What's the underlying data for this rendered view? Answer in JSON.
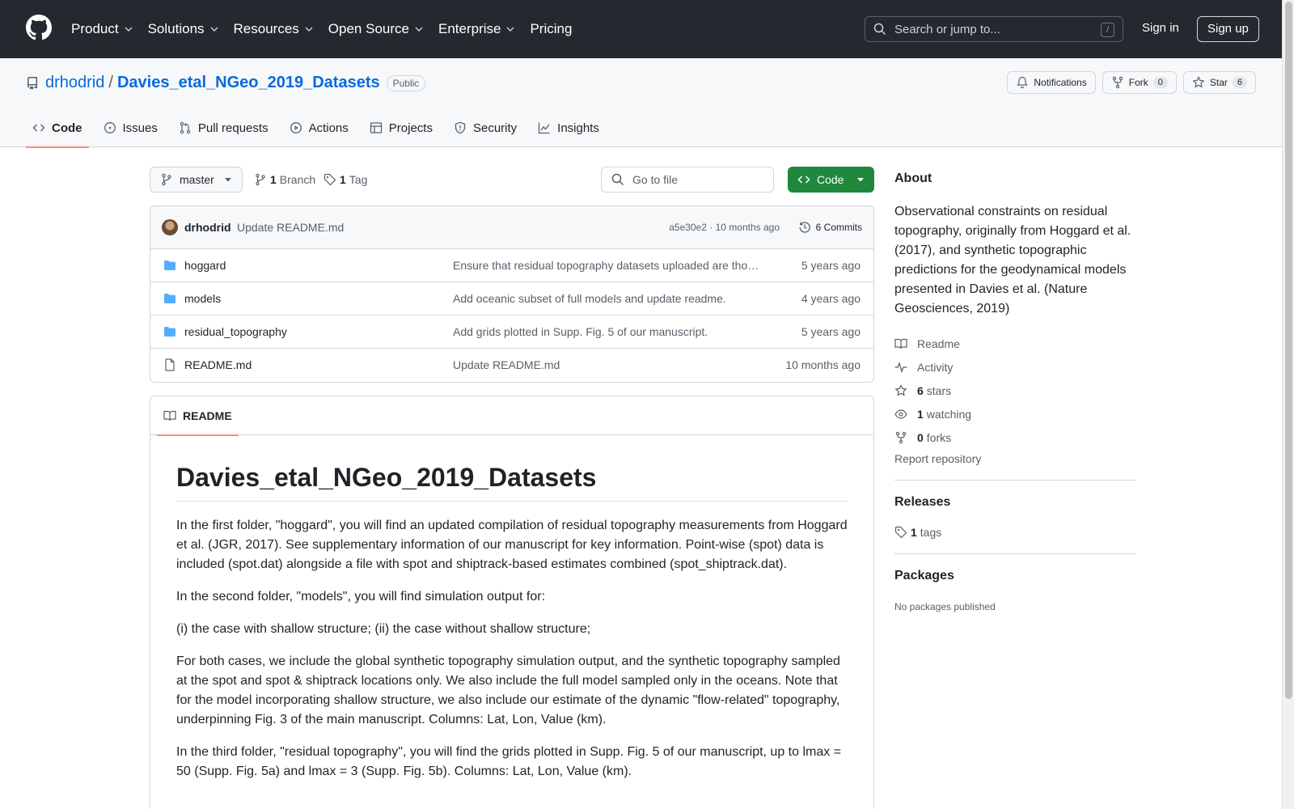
{
  "header": {
    "nav": [
      "Product",
      "Solutions",
      "Resources",
      "Open Source",
      "Enterprise",
      "Pricing"
    ],
    "search_placeholder": "Search or jump to...",
    "search_shortcut": "/",
    "signin": "Sign in",
    "signup": "Sign up"
  },
  "repo": {
    "owner": "drhodrid",
    "sep": "/",
    "name": "Davies_etal_NGeo_2019_Datasets",
    "visibility": "Public",
    "notifications": "Notifications",
    "fork_label": "Fork",
    "fork_count": "0",
    "star_label": "Star",
    "star_count": "6",
    "tabs": [
      "Code",
      "Issues",
      "Pull requests",
      "Actions",
      "Projects",
      "Security",
      "Insights"
    ]
  },
  "toolbar": {
    "branch": "master",
    "branch_count": "1",
    "branch_label": "Branch",
    "tag_count": "1",
    "tag_label": "Tag",
    "gofile_placeholder": "Go to file",
    "code_button": "Code"
  },
  "commit": {
    "author": "drhodrid",
    "message": "Update README.md",
    "hash_time": "a5e30e2 · 10 months ago",
    "commits": "6 Commits"
  },
  "files": [
    {
      "type": "dir",
      "name": "hoggard",
      "message": "Ensure that residual topography datasets uploaded are tho…",
      "age": "5 years ago"
    },
    {
      "type": "dir",
      "name": "models",
      "message": "Add oceanic subset of full models and update readme.",
      "age": "4 years ago"
    },
    {
      "type": "dir",
      "name": "residual_topography",
      "message": "Add grids plotted in Supp. Fig. 5 of our manuscript.",
      "age": "5 years ago"
    },
    {
      "type": "file",
      "name": "README.md",
      "message": "Update README.md",
      "age": "10 months ago"
    }
  ],
  "readme": {
    "tab": "README",
    "title": "Davies_etal_NGeo_2019_Datasets",
    "paragraphs": [
      "In the first folder, \"hoggard\", you will find an updated compilation of residual topography measurements from Hoggard et al. (JGR, 2017). See supplementary information of our manuscript for key information. Point-wise (spot) data is included (spot.dat) alongside a file with spot and shiptrack-based estimates combined (spot_shiptrack.dat).",
      "In the second folder, \"models\", you will find simulation output for:",
      "(i) the case with shallow structure; (ii) the case without shallow structure;",
      "For both cases, we include the global synthetic topography simulation output, and the synthetic topography sampled at the spot and spot & shiptrack locations only. We also include the full model sampled only in the oceans. Note that for the model incorporating shallow structure, we also include our estimate of the dynamic \"flow-related\" topography, underpinning Fig. 3 of the main manuscript. Columns: Lat, Lon, Value (km).",
      "In the third folder, \"residual topography\", you will find the grids plotted in Supp. Fig. 5 of our manuscript, up to lmax = 50 (Supp. Fig. 5a) and lmax = 3 (Supp. Fig. 5b). Columns: Lat, Lon, Value (km)."
    ]
  },
  "sidebar": {
    "about_title": "About",
    "description": "Observational constraints on residual topography, originally from Hoggard et al. (2017), and synthetic topographic predictions for the geodynamical models presented in Davies et al. (Nature Geosciences, 2019)",
    "readme": "Readme",
    "activity": "Activity",
    "stars_count": "6",
    "stars_label": "stars",
    "watching_count": "1",
    "watching_label": "watching",
    "forks_count": "0",
    "forks_label": "forks",
    "report": "Report repository",
    "releases_title": "Releases",
    "tags_count": "1",
    "tags_label": "tags",
    "packages_title": "Packages",
    "no_packages": "No packages published"
  }
}
